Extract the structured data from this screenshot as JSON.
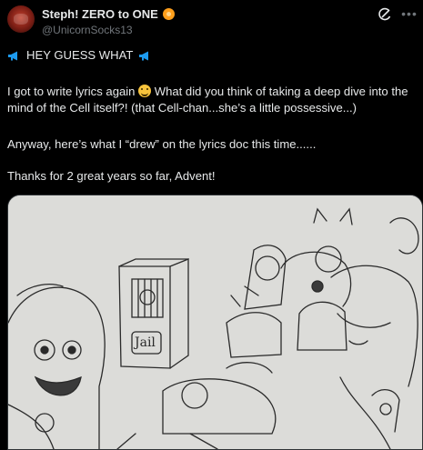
{
  "author": {
    "display_name": "Steph! ZERO to ONE",
    "handle": "@UnicornSocks13",
    "badge_icon": "orange-circle-emoji"
  },
  "post": {
    "line1_text": "HEY GUESS WHAT",
    "para2_before": "I got to write lyrics again ",
    "para2_after": " What did you think of taking a deep dive into the mind of the Cell itself?! (that Cell-chan...she’s a little possessive...)",
    "para3": "Anyway, here’s what I “drew” on the lyrics doc this time......",
    "para4": "Thanks for 2 great years so far, Advent!"
  },
  "media": {
    "type": "pencil-sketch",
    "jail_label": "Jail"
  },
  "colors": {
    "background": "#000000",
    "text": "#e7e9ea",
    "muted": "#71767b",
    "megaphone": "#1d9bf0",
    "badge": "#ff9f1c"
  }
}
